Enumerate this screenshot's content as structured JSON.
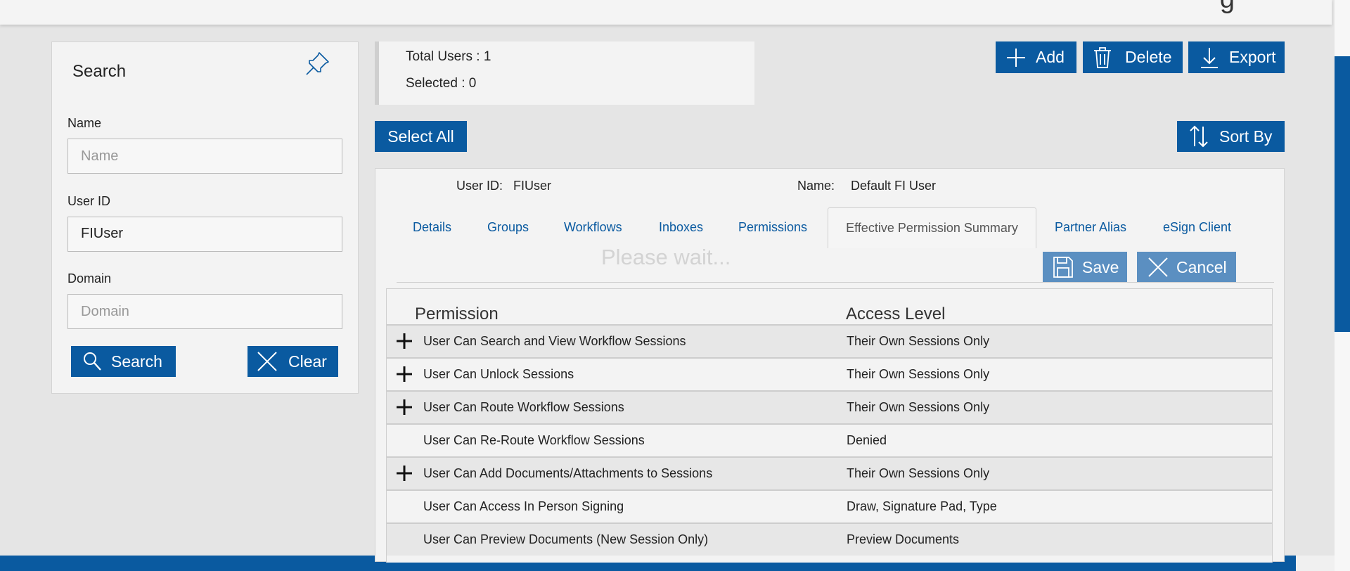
{
  "search": {
    "title": "Search",
    "name_label": "Name",
    "name_placeholder": "Name",
    "userid_label": "User ID",
    "userid_value": "FIUser",
    "domain_label": "Domain",
    "domain_placeholder": "Domain",
    "search_button": "Search",
    "clear_button": "Clear"
  },
  "counts": {
    "total": "Total Users : 1",
    "selected": "Selected : 0"
  },
  "toolbar": {
    "add": "Add",
    "delete": "Delete",
    "export": "Export",
    "select_all": "Select All",
    "sort_by": "Sort By"
  },
  "user": {
    "userid_label": "User ID:",
    "userid_value": "FIUser",
    "name_label": "Name:",
    "name_value": "Default FI User"
  },
  "tabs": [
    "Details",
    "Groups",
    "Workflows",
    "Inboxes",
    "Permissions",
    "Effective Permission Summary",
    "Partner Alias",
    "eSign Client"
  ],
  "active_tab": "Effective Permission Summary",
  "status": "Please wait...",
  "actions": {
    "save": "Save",
    "cancel": "Cancel"
  },
  "table": {
    "headers": [
      "Permission",
      "Access Level"
    ],
    "rows": [
      {
        "permission": "User Can Search and View Workflow Sessions",
        "access": "Their Own Sessions Only",
        "expandable": true
      },
      {
        "permission": "User Can Unlock Sessions",
        "access": "Their Own Sessions Only",
        "expandable": true
      },
      {
        "permission": "User Can Route Workflow Sessions",
        "access": "Their Own Sessions Only",
        "expandable": true
      },
      {
        "permission": "User Can Re-Route Workflow Sessions",
        "access": "Denied",
        "expandable": false
      },
      {
        "permission": "User Can Add Documents/Attachments to Sessions",
        "access": "Their Own Sessions Only",
        "expandable": true
      },
      {
        "permission": "User Can Access In Person Signing",
        "access": "Draw, Signature Pad, Type",
        "expandable": false
      },
      {
        "permission": "User Can Preview Documents (New Session Only)",
        "access": "Preview Documents",
        "expandable": false
      }
    ]
  },
  "colors": {
    "primary": "#0a5aa0",
    "primary_disabled": "#5b8fc1",
    "panel": "#f3f3f3",
    "background": "#e5e5e5"
  }
}
